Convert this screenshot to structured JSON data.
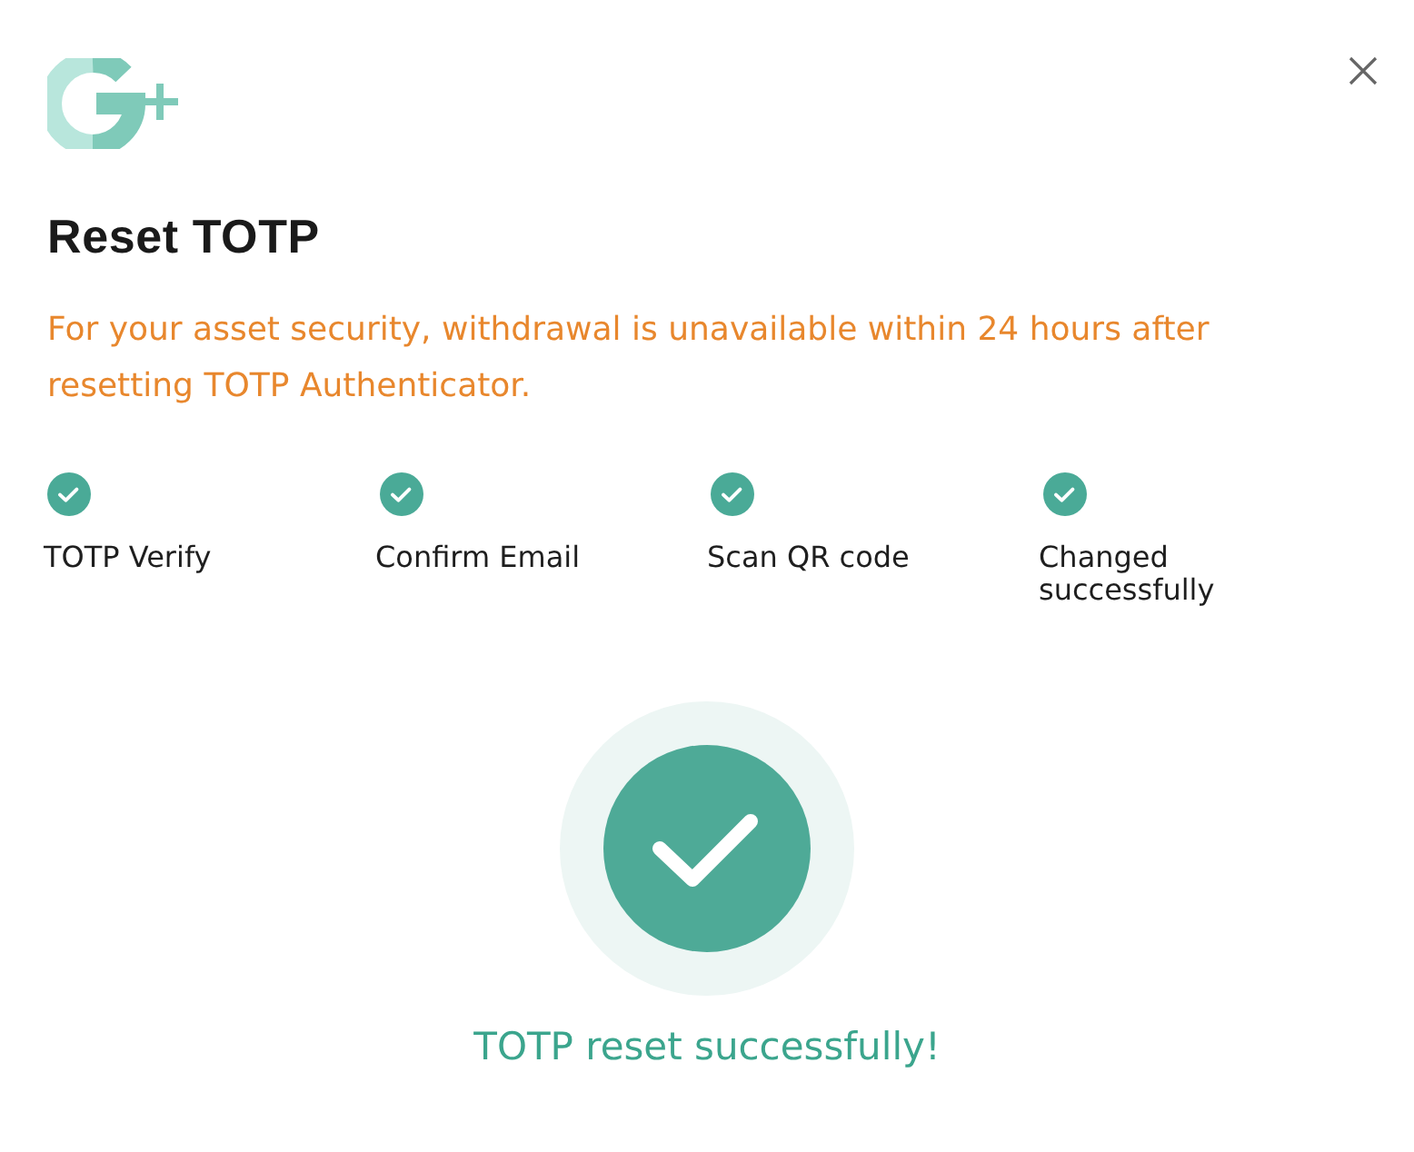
{
  "dialog": {
    "title": "Reset TOTP",
    "warning": "For your asset security, withdrawal is unavailable within 24 hours after resetting TOTP Authenticator."
  },
  "steps": [
    {
      "label": "TOTP Verify",
      "completed": true
    },
    {
      "label": "Confirm Email",
      "completed": true
    },
    {
      "label": "Scan QR code",
      "completed": true
    },
    {
      "label": "Changed successfully",
      "completed": true
    }
  ],
  "result": {
    "message": "TOTP reset successfully!"
  }
}
